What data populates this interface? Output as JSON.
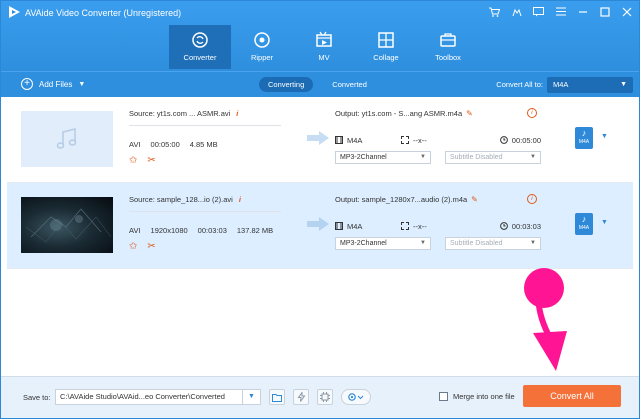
{
  "window": {
    "title": "AVAide Video Converter (Unregistered)"
  },
  "nav": {
    "items": [
      {
        "label": "Converter",
        "icon": "converter-icon",
        "active": true
      },
      {
        "label": "Ripper",
        "icon": "ripper-icon",
        "active": false
      },
      {
        "label": "MV",
        "icon": "mv-icon",
        "active": false
      },
      {
        "label": "Collage",
        "icon": "collage-icon",
        "active": false
      },
      {
        "label": "Toolbox",
        "icon": "toolbox-icon",
        "active": false
      }
    ]
  },
  "toolbar": {
    "add_files_label": "Add Files",
    "tabs": [
      {
        "label": "Converting",
        "active": true
      },
      {
        "label": "Converted",
        "active": false
      }
    ],
    "convert_all_to_label": "Convert All to:",
    "convert_all_format": "M4A"
  },
  "files": [
    {
      "source": "Source: yt1s.com ... ASMR.avi",
      "container": "AVI",
      "resolution": "",
      "duration": "00:05:00",
      "size": "4.85 MB",
      "output": "Output: yt1s.com - S...ang ASMR.m4a",
      "out_format": "M4A",
      "out_resolution": "--x--",
      "out_duration": "00:05:00",
      "audio_track": "MP3-2Channel",
      "subtitle": "Subtitle Disabled",
      "format_badge": "M4A",
      "thumb": "music-note-icon"
    },
    {
      "source": "Source: sample_128...io (2).avi",
      "container": "AVI",
      "resolution": "1920x1080",
      "duration": "00:03:03",
      "size": "137.82 MB",
      "output": "Output: sample_1280x7...audio (2).m4a",
      "out_format": "M4A",
      "out_resolution": "--x--",
      "out_duration": "00:03:03",
      "audio_track": "MP3-2Channel",
      "subtitle": "Subtitle Disabled",
      "format_badge": "M4A",
      "thumb": "video-thumbnail"
    }
  ],
  "bottom": {
    "save_to_label": "Save to:",
    "save_path": "C:\\AVAide Studio\\AVAid...eo Converter\\Converted",
    "merge_label": "Merge into one file",
    "merge_checked": false,
    "convert_all_button": "Convert All"
  },
  "colors": {
    "header": "#2f8fdf",
    "active_nav": "#1f6fb8",
    "accent": "#f4713a",
    "pointer": "#ff1493"
  }
}
